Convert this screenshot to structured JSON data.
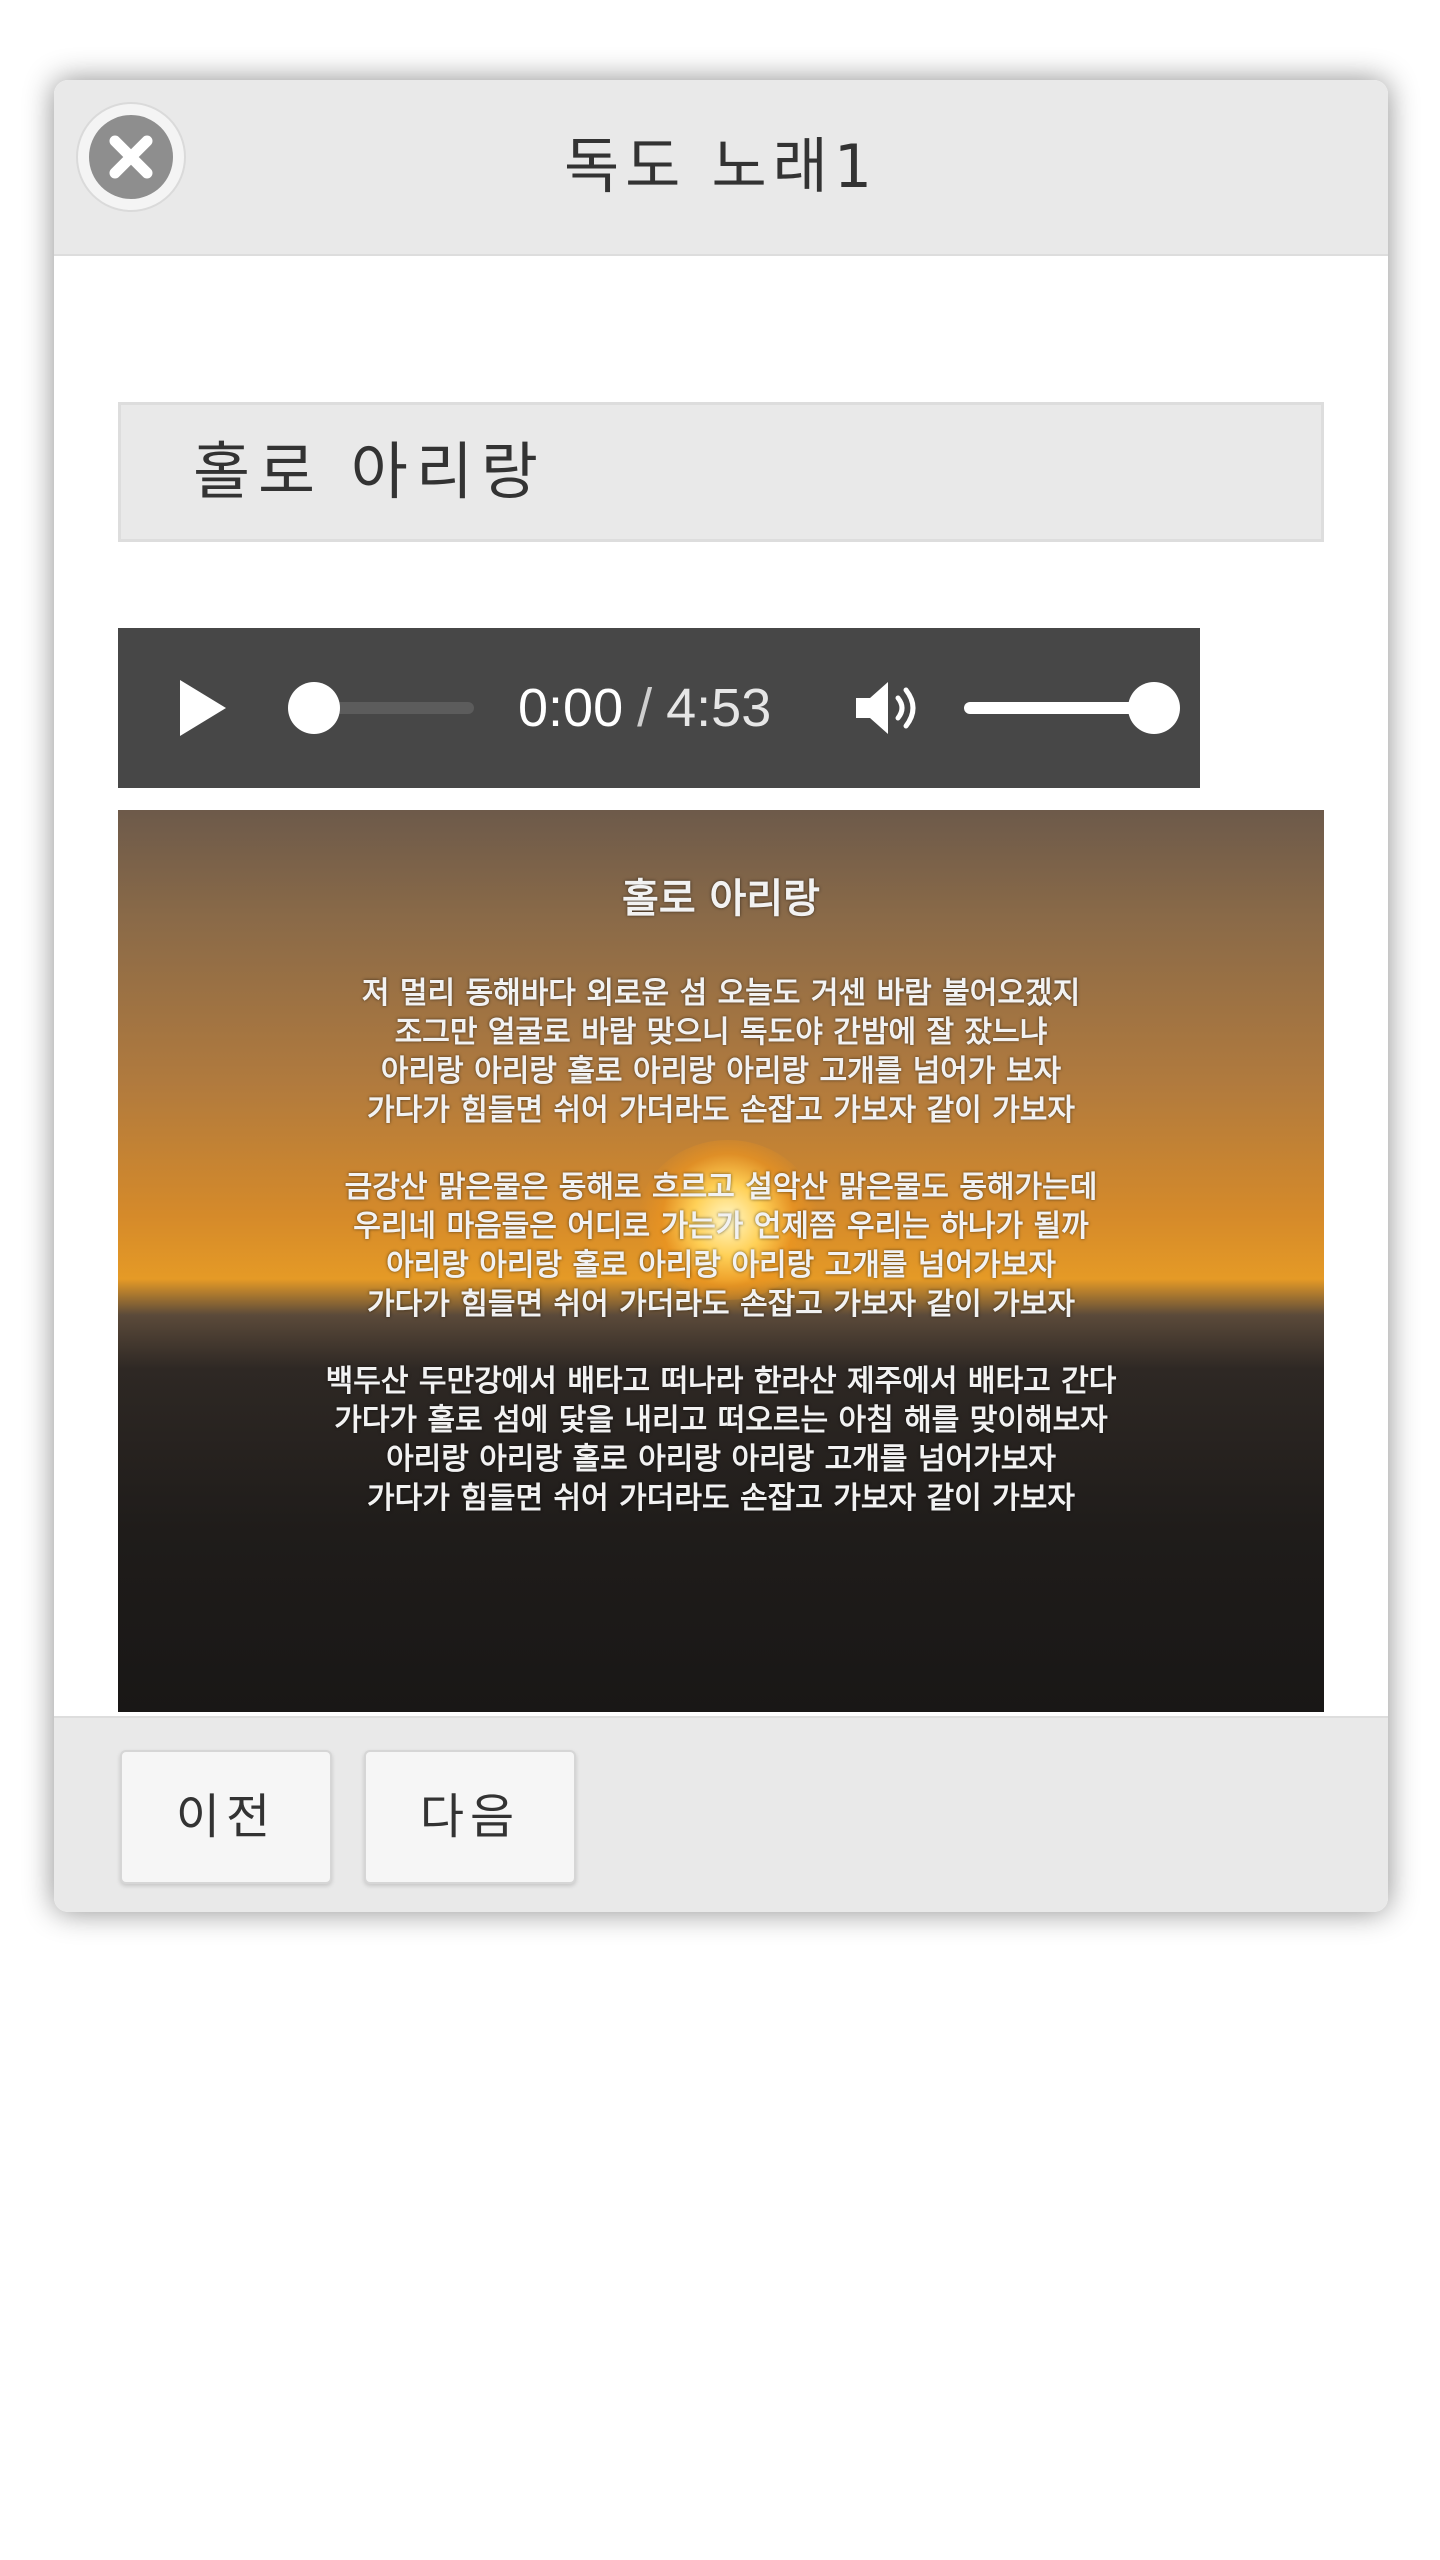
{
  "dialog": {
    "title": "독도 노래1",
    "close_icon": "close-circle-icon"
  },
  "song": {
    "title": "홀로 아리랑"
  },
  "player": {
    "current_time": "0:00",
    "separator": "/",
    "duration": "4:53",
    "progress_fraction": 0.0,
    "volume_fraction": 1.0,
    "play_icon": "play-icon",
    "volume_icon": "volume-icon"
  },
  "lyrics_image": {
    "title": "홀로 아리랑",
    "verses": [
      [
        "저 멀리 동해바다 외로운 섬 오늘도 거센 바람 불어오겠지",
        "조그만 얼굴로 바람 맞으니 독도야 간밤에 잘 잤느냐",
        "아리랑 아리랑 홀로 아리랑 아리랑 고개를 넘어가 보자",
        "가다가 힘들면 쉬어 가더라도 손잡고 가보자 같이 가보자"
      ],
      [
        "금강산 맑은물은 동해로 흐르고 설악산 맑은물도 동해가는데",
        "우리네 마음들은 어디로 가는가 언제쯤 우리는 하나가 될까",
        "아리랑 아리랑 홀로 아리랑 아리랑 고개를 넘어가보자",
        "가다가 힘들면 쉬어 가더라도 손잡고 가보자 같이 가보자"
      ],
      [
        "백두산 두만강에서 배타고 떠나라 한라산 제주에서 배타고 간다",
        "가다가 홀로 섬에 닻을 내리고 떠오르는 아침 해를 맞이해보자",
        "아리랑 아리랑 홀로 아리랑 아리랑 고개를 넘어가보자",
        "가다가 힘들면 쉬어 가더라도 손잡고 가보자 같이 가보자"
      ]
    ]
  },
  "footer": {
    "prev_label": "이전",
    "next_label": "다음"
  }
}
